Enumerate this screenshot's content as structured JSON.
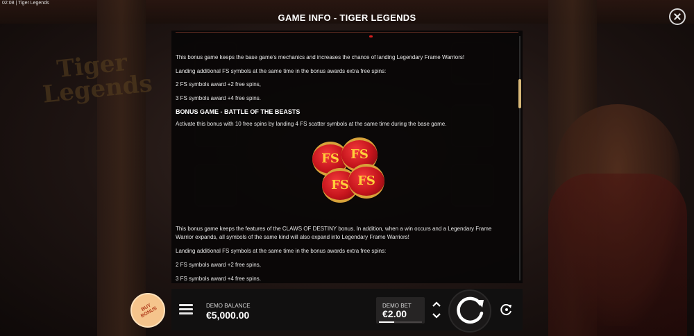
{
  "status_bar": {
    "time_and_app": "02:08  |  Tiger Legends"
  },
  "header": {
    "title": "GAME INFO - TIGER LEGENDS"
  },
  "scene": {
    "logo_text": "Tiger Legends"
  },
  "content": {
    "para1": "This bonus game keeps the base game's mechanics and increases the chance of landing Legendary Frame Warriors!",
    "para2": "Landing additional FS symbols at the same time in the bonus awards extra free spins:",
    "para3": "2 FS symbols award +2 free spins,",
    "para4": "3 FS symbols award +4 free spins.",
    "heading": "BONUS GAME - BATTLE OF THE BEASTS",
    "para5": "Activate this bonus with 10 free spins by landing 4 FS scatter symbols at the same time during the base game.",
    "lantern_text": "FS",
    "para6": "This bonus game keeps the features of the CLAWS OF DESTINY bonus. In addition, when a win occurs and a Legendary Frame Warrior expands, all symbols of the same kind will also expand into Legendary Frame Warriors!",
    "para7": "Landing additional FS symbols at the same time in the bonus awards extra free spins:",
    "para8": "2 FS symbols award +2 free spins,",
    "para9": "3 FS symbols award +4 free spins."
  },
  "bottom_bar": {
    "buy_bonus_label": "BUY BONUS",
    "balance_label": "DEMO BALANCE",
    "balance_value": "€5,000.00",
    "bet_label": "DEMO BET",
    "bet_value": "€2.00",
    "bet_level_fraction": 0.35
  },
  "colors": {
    "accent_gold": "#d8b878",
    "buy_bonus_bg": "#f5c48c",
    "lantern_red": "#c4141c",
    "lantern_text": "#ffcf3a"
  },
  "icons": [
    "close-icon",
    "menu-icon",
    "chevron-up-icon",
    "chevron-down-icon",
    "spin-icon",
    "autoplay-icon"
  ]
}
